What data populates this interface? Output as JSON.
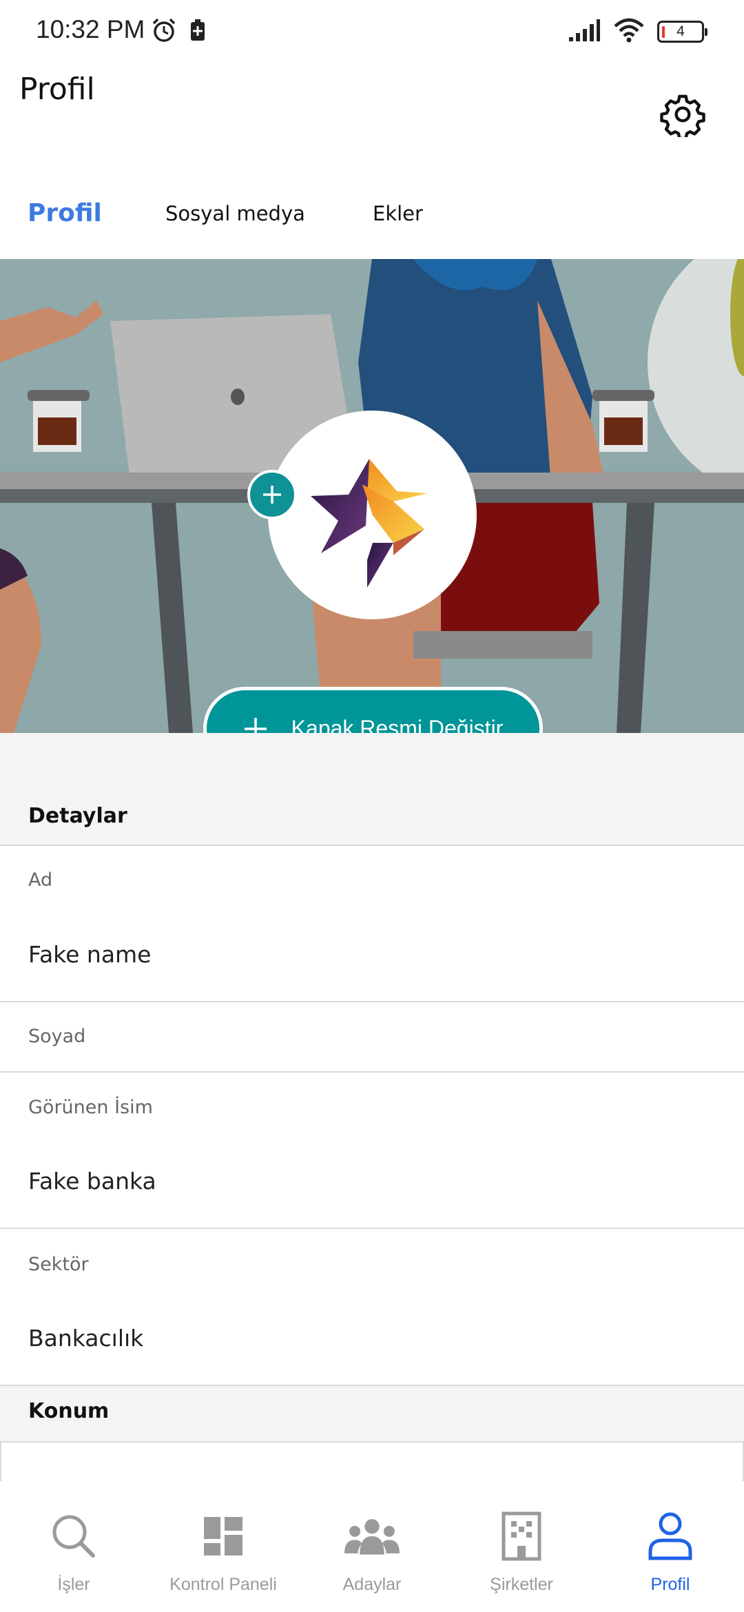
{
  "status_bar": {
    "time": "10:32 PM",
    "battery_level": "4",
    "icons": [
      "alarm-icon",
      "battery-saver-icon",
      "signal-icon",
      "wifi-icon",
      "battery-icon"
    ]
  },
  "header": {
    "title": "Profil",
    "settings_icon": "gear-icon"
  },
  "tabs": [
    {
      "label": "Profil",
      "active": true
    },
    {
      "label": "Sosyal medya",
      "active": false
    },
    {
      "label": "Ekler",
      "active": false
    }
  ],
  "cover": {
    "change_cover_label": "Kapak Resmi Değiştir",
    "accent_color": "#009598"
  },
  "details": {
    "section_title": "Detaylar",
    "fields": [
      {
        "label": "Ad",
        "value": "Fake name"
      },
      {
        "label": "Soyad",
        "value": ""
      },
      {
        "label": "Görünen İsim",
        "value": "Fake banka"
      },
      {
        "label": "Sektör",
        "value": "Bankacılık"
      }
    ]
  },
  "location": {
    "section_title": "Konum"
  },
  "bottom_nav": {
    "active_color": "#1f63e6",
    "items": [
      {
        "label": "İşler",
        "icon": "search-icon",
        "active": false
      },
      {
        "label": "Kontrol Paneli",
        "icon": "dashboard-icon",
        "active": false
      },
      {
        "label": "Adaylar",
        "icon": "people-icon",
        "active": false
      },
      {
        "label": "Şirketler",
        "icon": "building-icon",
        "active": false
      },
      {
        "label": "Profil",
        "icon": "user-icon",
        "active": true
      }
    ]
  }
}
